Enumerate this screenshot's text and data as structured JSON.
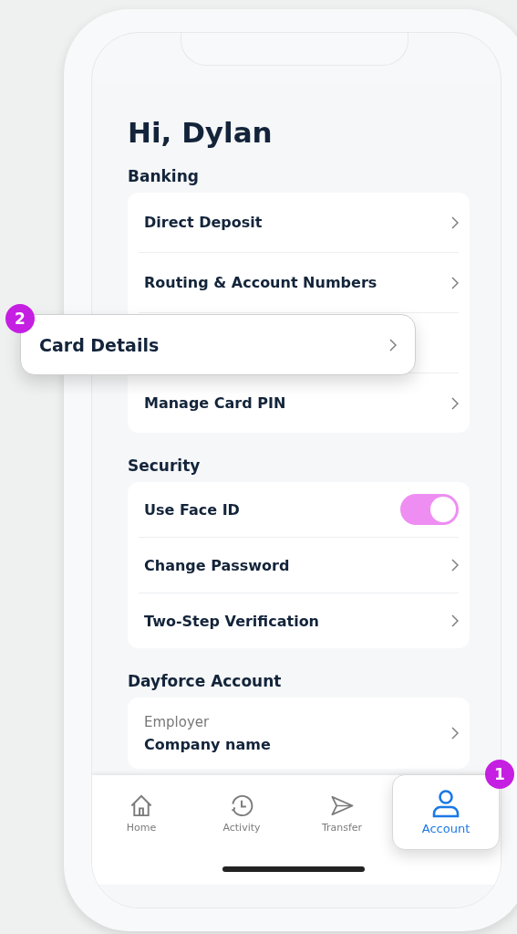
{
  "greeting": "Hi, Dylan",
  "sections": [
    {
      "title": "Banking",
      "items": [
        {
          "kind": "link",
          "label": "Direct Deposit"
        },
        {
          "kind": "link",
          "label": "Routing & Account Numbers"
        },
        {
          "kind": "covered"
        },
        {
          "kind": "link",
          "label": "Manage Card PIN"
        }
      ]
    },
    {
      "title": "Security",
      "items": [
        {
          "kind": "toggle",
          "label": "Use Face ID",
          "on": true
        },
        {
          "kind": "link",
          "label": "Change Password"
        },
        {
          "kind": "link",
          "label": "Two-Step Verification"
        }
      ]
    },
    {
      "title": "Dayforce Account",
      "items": [
        {
          "kind": "field",
          "caption": "Employer",
          "label": "Company name"
        }
      ]
    }
  ],
  "callout": {
    "badge": "2",
    "label": "Card Details"
  },
  "tabs": [
    {
      "label": "Home",
      "selected": false
    },
    {
      "label": "Activity",
      "selected": false
    },
    {
      "label": "Transfer",
      "selected": false
    },
    {
      "label": "Account",
      "selected": true,
      "badge": "1"
    }
  ]
}
